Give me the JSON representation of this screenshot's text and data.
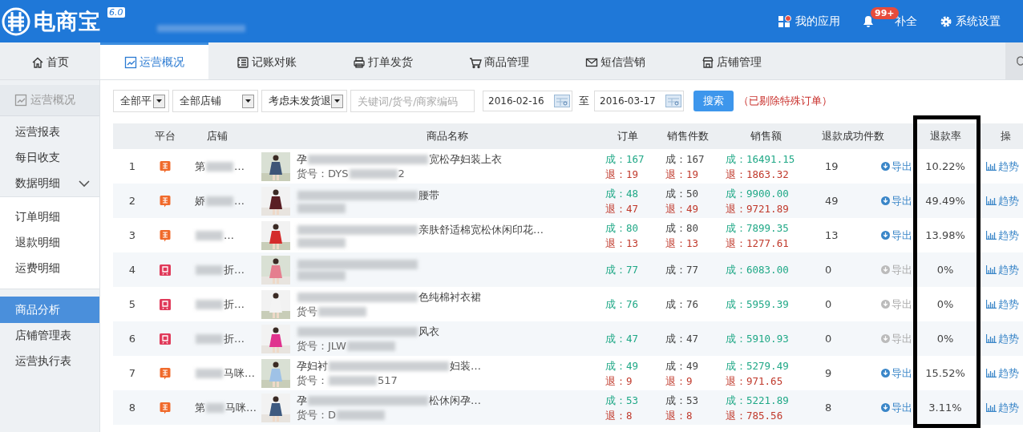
{
  "header": {
    "logo": "电商宝",
    "version": "6.0",
    "actions": [
      {
        "kind": "apps",
        "label": "我的应用"
      },
      {
        "kind": "bell",
        "label": "补全",
        "badge": "99+"
      },
      {
        "kind": "gear",
        "label": "系统设置"
      }
    ]
  },
  "nav_tabs": [
    {
      "kind": "home",
      "label": "首页",
      "selected": false
    },
    {
      "kind": "chart",
      "label": "运营概况",
      "selected": true
    },
    {
      "kind": "ledger",
      "label": "记账对账",
      "selected": false
    },
    {
      "kind": "printer",
      "label": "打单发货",
      "selected": false
    },
    {
      "kind": "cart",
      "label": "商品管理",
      "selected": false
    },
    {
      "kind": "mail",
      "label": "短信营销",
      "selected": false
    },
    {
      "kind": "store",
      "label": "店铺管理",
      "selected": false
    }
  ],
  "sidebar": {
    "title": "运营概况",
    "items": [
      {
        "label": "运营报表",
        "selected": false
      },
      {
        "label": "每日收支",
        "selected": false
      },
      {
        "label": "数据明细",
        "selected": false,
        "expanded": true,
        "children": [
          {
            "label": "订单明细",
            "selected": false
          },
          {
            "label": "退款明细",
            "selected": false
          },
          {
            "label": "运费明细",
            "selected": false
          }
        ]
      },
      {
        "label": "商品分析",
        "selected": true
      },
      {
        "label": "店铺管理表",
        "selected": false
      },
      {
        "label": "运营执行表",
        "selected": false
      }
    ]
  },
  "filters": {
    "selects": [
      "全部平",
      "全部店铺",
      "考虑未发货退"
    ],
    "search": {
      "placeholder": "关键词/货号/商家编码"
    },
    "date_from": "2016-02-16",
    "date_sep": "至",
    "date_to": "2016-03-17",
    "button": "搜索",
    "note": "（已剔除特殊订单）"
  },
  "table": {
    "columns": [
      "",
      "平台",
      "店铺",
      "",
      "商品名称",
      "订单",
      "销售件数",
      "销售额",
      "退款成功件数",
      "",
      "退款率",
      "操"
    ],
    "rows": [
      {
        "index": "1",
        "platform": {
          "kind": "tao"
        },
        "store": [
          {
            "kind": "text",
            "text": "第"
          },
          {
            "kind": "blur"
          },
          {
            "kind": "text",
            "text": "…"
          }
        ],
        "name": [
          {
            "kind": "text",
            "text": "孕"
          },
          {
            "kind": "blur"
          },
          {
            "kind": "text",
            "text": "宽松孕妇装上衣"
          }
        ],
        "sku": [
          {
            "kind": "text",
            "text": "货号：DYS"
          },
          {
            "kind": "blur"
          },
          {
            "kind": "text",
            "text": "2"
          }
        ],
        "orders": [
          "成：167",
          "退：19"
        ],
        "count": [
          "成：167",
          "退：19"
        ],
        "amount": [
          "成：16491.15",
          "退：1863.32"
        ],
        "refunds": "19",
        "export": {
          "label": "导出",
          "disabled": false
        },
        "rate": "10.22%",
        "trend": "趋势"
      },
      {
        "index": "2",
        "platform": {
          "kind": "tao"
        },
        "store": [
          {
            "kind": "text",
            "text": "娇"
          },
          {
            "kind": "blur"
          },
          {
            "kind": "text",
            "text": "…"
          }
        ],
        "name": [
          {
            "kind": "blur"
          },
          {
            "kind": "text",
            "text": "腰带"
          }
        ],
        "sku": [
          {
            "kind": "blur"
          }
        ],
        "orders": [
          "成：48",
          "退：47"
        ],
        "count": [
          "成：50",
          "退：49"
        ],
        "amount": [
          "成：9900.00",
          "退：9721.89"
        ],
        "refunds": "49",
        "export": {
          "label": "导出",
          "disabled": false
        },
        "rate": "49.49%",
        "trend": "趋势"
      },
      {
        "index": "3",
        "platform": {
          "kind": "tao"
        },
        "store": [
          {
            "kind": "blur"
          },
          {
            "kind": "text",
            "text": "…"
          }
        ],
        "name": [
          {
            "kind": "blur"
          },
          {
            "kind": "text",
            "text": "亲肤舒适棉宽松休闲印花…"
          }
        ],
        "sku": [
          {
            "kind": "blur"
          }
        ],
        "orders": [
          "成：80",
          "退：13"
        ],
        "count": [
          "成：80",
          "退：13"
        ],
        "amount": [
          "成：7899.35",
          "退：1277.61"
        ],
        "refunds": "13",
        "export": {
          "label": "导出",
          "disabled": false
        },
        "rate": "13.98%",
        "trend": "趋势"
      },
      {
        "index": "4",
        "platform": {
          "kind": "bei"
        },
        "store": [
          {
            "kind": "blur"
          },
          {
            "kind": "text",
            "text": "折…"
          }
        ],
        "name": [
          {
            "kind": "blur"
          }
        ],
        "sku": [
          {
            "kind": "blur"
          }
        ],
        "orders": [
          "成：77"
        ],
        "count": [
          "成：77"
        ],
        "amount": [
          "成：6083.00"
        ],
        "refunds": "0",
        "export": {
          "label": "导出",
          "disabled": true
        },
        "rate": "0%",
        "trend": "趋势"
      },
      {
        "index": "5",
        "platform": {
          "kind": "bei"
        },
        "store": [
          {
            "kind": "blur"
          },
          {
            "kind": "text",
            "text": "折…"
          }
        ],
        "name": [
          {
            "kind": "blur"
          },
          {
            "kind": "text",
            "text": "色纯棉衬衣裙"
          }
        ],
        "sku": [
          {
            "kind": "text",
            "text": "货号"
          },
          {
            "kind": "blur"
          }
        ],
        "orders": [
          "成：76"
        ],
        "count": [
          "成：76"
        ],
        "amount": [
          "成：5959.39"
        ],
        "refunds": "0",
        "export": {
          "label": "导出",
          "disabled": true
        },
        "rate": "0%",
        "trend": "趋势"
      },
      {
        "index": "6",
        "platform": {
          "kind": "bei"
        },
        "store": [
          {
            "kind": "blur"
          },
          {
            "kind": "text",
            "text": "折…"
          }
        ],
        "name": [
          {
            "kind": "blur"
          },
          {
            "kind": "text",
            "text": "风衣"
          }
        ],
        "sku": [
          {
            "kind": "text",
            "text": "货号：JLW"
          },
          {
            "kind": "blur"
          }
        ],
        "orders": [
          "成：47"
        ],
        "count": [
          "成：47"
        ],
        "amount": [
          "成：5910.93"
        ],
        "refunds": "0",
        "export": {
          "label": "导出",
          "disabled": true
        },
        "rate": "0%",
        "trend": "趋势"
      },
      {
        "index": "7",
        "platform": {
          "kind": "tao"
        },
        "store": [
          {
            "kind": "blur"
          },
          {
            "kind": "text",
            "text": "马咪…"
          }
        ],
        "name": [
          {
            "kind": "text",
            "text": "孕妇衬"
          },
          {
            "kind": "blur"
          },
          {
            "kind": "text",
            "text": "妇装…"
          }
        ],
        "sku": [
          {
            "kind": "text",
            "text": "货号："
          },
          {
            "kind": "blur"
          },
          {
            "kind": "text",
            "text": "517"
          }
        ],
        "orders": [
          "成：49",
          "退：9"
        ],
        "count": [
          "成：49",
          "退：9"
        ],
        "amount": [
          "成：5279.49",
          "退：971.65"
        ],
        "refunds": "9",
        "export": {
          "label": "导出",
          "disabled": false
        },
        "rate": "15.52%",
        "trend": "趋势"
      },
      {
        "index": "8",
        "platform": {
          "kind": "tao"
        },
        "store": [
          {
            "kind": "text",
            "text": "第"
          },
          {
            "kind": "blur"
          },
          {
            "kind": "text",
            "text": "马咪…"
          }
        ],
        "name": [
          {
            "kind": "text",
            "text": "孕"
          },
          {
            "kind": "blur"
          },
          {
            "kind": "text",
            "text": "松休闲孕…"
          }
        ],
        "sku": [
          {
            "kind": "text",
            "text": "货号：D"
          },
          {
            "kind": "blur"
          }
        ],
        "orders": [
          "成：53",
          "退：8"
        ],
        "count": [
          "成：53",
          "退：8"
        ],
        "amount": [
          "成：5221.89",
          "退：785.56"
        ],
        "refunds": "8",
        "export": {
          "label": "导出",
          "disabled": false
        },
        "rate": "3.11%",
        "trend": "趋势"
      }
    ]
  }
}
